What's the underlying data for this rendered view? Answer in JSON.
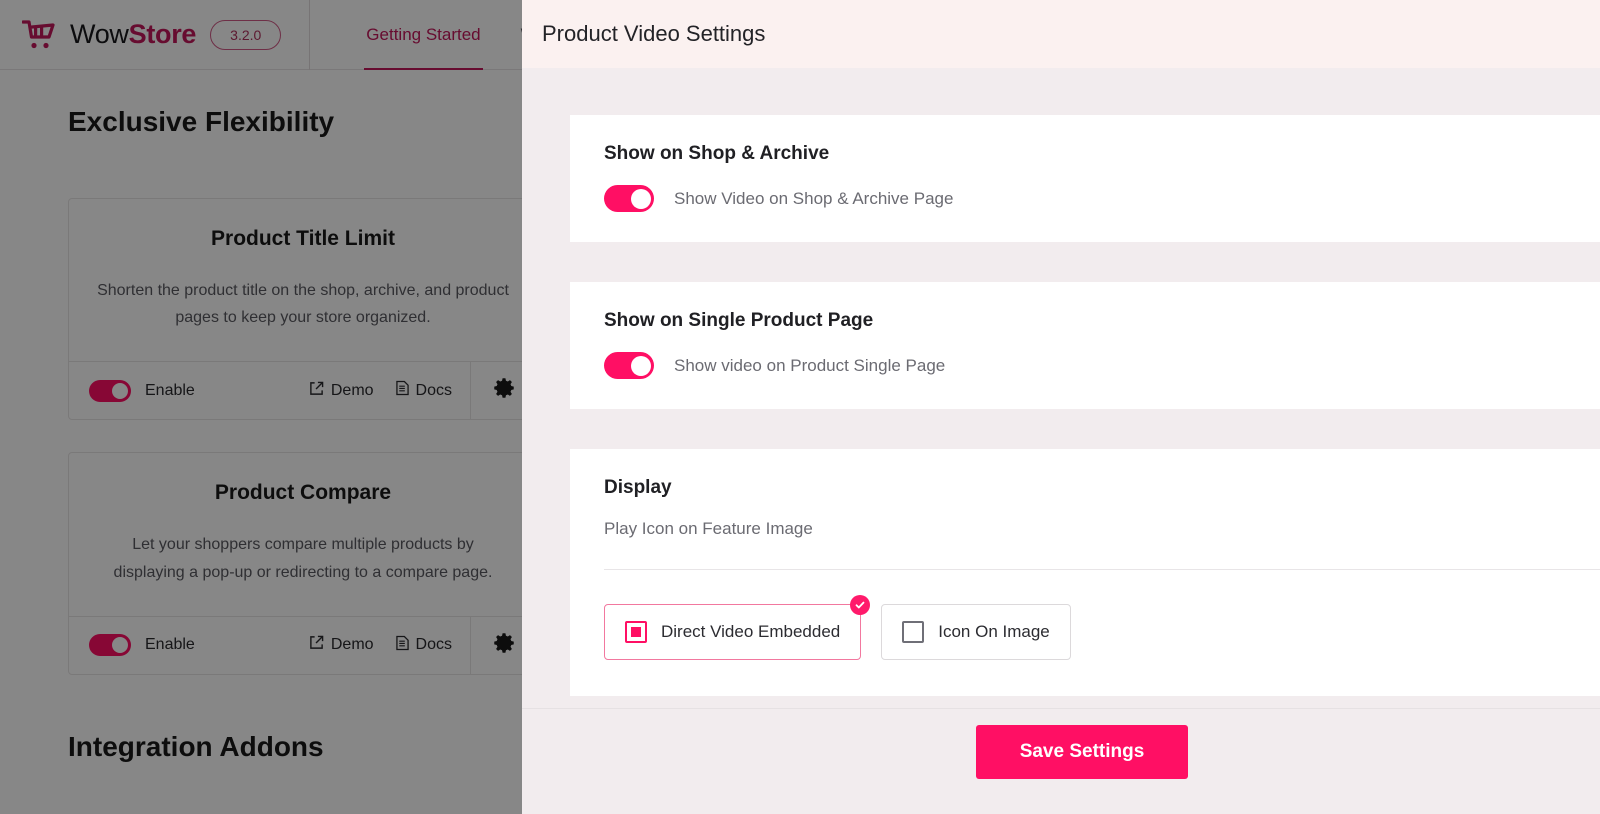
{
  "background": {
    "brand": {
      "name_light": "Wow",
      "name_bold": "Store",
      "logo_icon": "shopping-cart-icon",
      "version": "3.2.0"
    },
    "nav": [
      {
        "label": "Getting Started",
        "active": true
      },
      {
        "label": "W",
        "active": false
      }
    ],
    "sections": [
      {
        "title": "Exclusive Flexibility"
      },
      {
        "title": "Integration Addons"
      }
    ],
    "addons": [
      {
        "title": "Product Title Limit",
        "description": "Shorten the product title on the shop, archive, and product pages to keep your store organized.",
        "enable_label": "Enable",
        "enabled": true,
        "demo_label": "Demo",
        "docs_label": "Docs",
        "demo_icon": "external-link-icon",
        "docs_icon": "document-icon",
        "settings_icon": "gear-icon"
      },
      {
        "title": "Product Compare",
        "description": "Let your shoppers compare multiple products by displaying a pop-up or redirecting to a compare page.",
        "enable_label": "Enable",
        "enabled": true,
        "demo_label": "Demo",
        "docs_label": "Docs",
        "demo_icon": "external-link-icon",
        "docs_icon": "document-icon",
        "settings_icon": "gear-icon"
      }
    ]
  },
  "modal": {
    "title": "Product Video Settings",
    "cards": [
      {
        "title": "Show on Shop & Archive",
        "toggle_label": "Show Video on Shop & Archive Page",
        "toggle_on": true
      },
      {
        "title": "Show on Single Product Page",
        "toggle_label": "Show video on Product Single Page",
        "toggle_on": true
      }
    ],
    "display": {
      "title": "Display",
      "subtitle": "Play Icon on Feature Image",
      "options": [
        {
          "label": "Direct Video Embedded",
          "selected": true,
          "badge_icon": "check-circle-icon"
        },
        {
          "label": "Icon On Image",
          "selected": false
        }
      ]
    },
    "footer": {
      "save_label": "Save Settings"
    }
  },
  "colors": {
    "accent_pink": "#FF0F64",
    "brand_crimson": "#C2185B",
    "modal_bg": "#F2ECEE",
    "modal_header_bg": "#FBF1F0",
    "selected_border": "#F2789F"
  }
}
